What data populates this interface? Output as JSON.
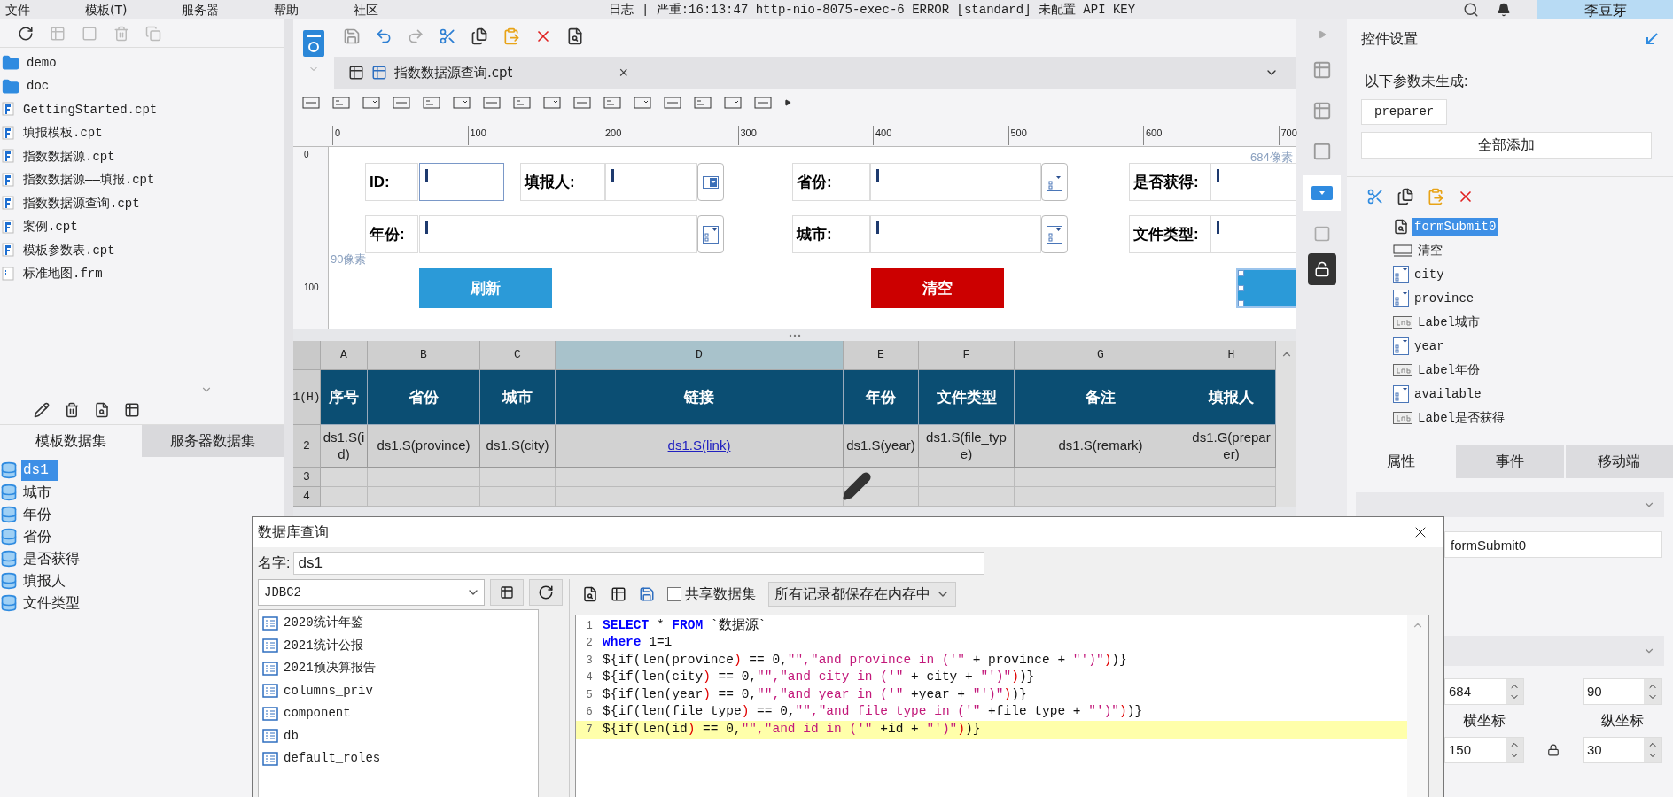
{
  "menu": [
    "文件",
    "模板(T)",
    "服务器",
    "帮助",
    "社区"
  ],
  "log": "日志 | 严重:16:13:47 http-nio-8075-exec-6 ERROR [standard] 未配置 API KEY",
  "user": "李豆芽",
  "file_tree": [
    {
      "label": "demo",
      "kind": "folder"
    },
    {
      "label": "doc",
      "kind": "folder"
    },
    {
      "label": "GettingStarted.cpt",
      "kind": "cpt"
    },
    {
      "label": "填报模板.cpt",
      "kind": "cpt"
    },
    {
      "label": "指数数据源.cpt",
      "kind": "cpt"
    },
    {
      "label": "指数数据源——填报.cpt",
      "kind": "cpt"
    },
    {
      "label": "指数数据源查询.cpt",
      "kind": "cpt"
    },
    {
      "label": "案例.cpt",
      "kind": "cpt"
    },
    {
      "label": "模板参数表.cpt",
      "kind": "cpt"
    },
    {
      "label": "标准地图.frm",
      "kind": "frm"
    }
  ],
  "dataset_tabs": [
    {
      "label": "模板数据集",
      "selected": true
    },
    {
      "label": "服务器数据集",
      "selected": false
    }
  ],
  "datasets": [
    {
      "label": "ds1",
      "selected": true
    },
    {
      "label": "城市",
      "selected": false
    },
    {
      "label": "年份",
      "selected": false
    },
    {
      "label": "省份",
      "selected": false
    },
    {
      "label": "是否获得",
      "selected": false
    },
    {
      "label": "填报人",
      "selected": false
    },
    {
      "label": "文件类型",
      "selected": false
    }
  ],
  "editor_tab": {
    "label": "指数数据源查询.cpt",
    "close": "×"
  },
  "ruler": [
    "0",
    "100",
    "200",
    "300",
    "400",
    "500",
    "600",
    "700"
  ],
  "vruler": [
    "0",
    "100"
  ],
  "canvas": {
    "width_note": "684像素",
    "height_note": "90像素",
    "widgets": [
      {
        "kind": "label",
        "text": "ID:"
      },
      {
        "kind": "input",
        "focused": true
      },
      {
        "kind": "label",
        "text": "填报人:"
      },
      {
        "kind": "input",
        "focused": false
      },
      {
        "kind": "dropdown"
      },
      {
        "kind": "label",
        "text": "省份:"
      },
      {
        "kind": "input",
        "focused": false
      },
      {
        "kind": "picker"
      },
      {
        "kind": "label",
        "text": "是否获得:"
      },
      {
        "kind": "input",
        "focused": false
      },
      {
        "kind": "label",
        "text": "年份:"
      },
      {
        "kind": "input",
        "focused": false
      },
      {
        "kind": "picker"
      },
      {
        "kind": "label",
        "text": "城市:"
      },
      {
        "kind": "input",
        "focused": false
      },
      {
        "kind": "picker"
      },
      {
        "kind": "label",
        "text": "文件类型:"
      },
      {
        "kind": "input",
        "focused": false
      },
      {
        "kind": "button",
        "text": "刷新",
        "color": "#2b9ad8",
        "selected": false
      },
      {
        "kind": "button",
        "text": "清空",
        "color": "#cc0000",
        "selected": false
      },
      {
        "kind": "button",
        "color": "#2b9ad8",
        "selected": true
      }
    ]
  },
  "sheet": {
    "columns": [
      {
        "label": "A",
        "selected": false
      },
      {
        "label": "B",
        "selected": false
      },
      {
        "label": "C",
        "selected": false
      },
      {
        "label": "D",
        "selected": true
      },
      {
        "label": "E",
        "selected": false
      },
      {
        "label": "F",
        "selected": false
      },
      {
        "label": "G",
        "selected": false
      },
      {
        "label": "H",
        "selected": false
      }
    ],
    "rows": [
      {
        "label": "1(H)",
        "kind": "header",
        "cells": [
          "序号",
          "省份",
          "城市",
          "链接",
          "年份",
          "文件类型",
          "备注",
          "填报人"
        ]
      },
      {
        "label": "2",
        "kind": "data",
        "cells": [
          {
            "text": "ds1.S(id)",
            "kind": "formula"
          },
          {
            "text": "ds1.S(province)",
            "kind": "formula"
          },
          {
            "text": "ds1.S(city)",
            "kind": "formula"
          },
          {
            "text": "ds1.S(link)",
            "kind": "link"
          },
          {
            "text": "ds1.S(year)",
            "kind": "formula"
          },
          {
            "text": "ds1.S(file_type)",
            "kind": "formula"
          },
          {
            "text": "ds1.S(remark)",
            "kind": "formula"
          },
          {
            "text": "ds1.G(preparer)",
            "kind": "formula"
          }
        ]
      },
      {
        "label": "3",
        "kind": "empty",
        "cells": []
      },
      {
        "label": "4",
        "kind": "empty",
        "cells": []
      }
    ]
  },
  "panel": {
    "title": "控件设置",
    "notice": "以下参数未生成:",
    "params": [
      "preparer"
    ],
    "add_all": "全部添加",
    "tree": [
      {
        "label": "formSubmit0",
        "kind": "submit",
        "selected": true
      },
      {
        "label": "清空",
        "kind": "button",
        "selected": false
      },
      {
        "label": "city",
        "kind": "combo",
        "selected": false
      },
      {
        "label": "province",
        "kind": "combo",
        "selected": false
      },
      {
        "label": "Label城市",
        "kind": "label",
        "selected": false
      },
      {
        "label": "year",
        "kind": "combo",
        "selected": false
      },
      {
        "label": "Label年份",
        "kind": "label",
        "selected": false
      },
      {
        "label": "available",
        "kind": "combo",
        "selected": false
      },
      {
        "label": "Label是否获得",
        "kind": "label",
        "selected": false
      }
    ],
    "tabs": [
      {
        "label": "属性",
        "selected": true
      },
      {
        "label": "事件",
        "selected": false
      },
      {
        "label": "移动端",
        "selected": false
      }
    ],
    "widget_name": "formSubmit0",
    "position": [
      {
        "value": "684",
        "label": "横坐标"
      },
      {
        "value": "90",
        "label": "纵坐标"
      }
    ],
    "size": [
      "150",
      "30"
    ]
  },
  "dialog": {
    "title": "数据库查询",
    "name_label": "名字:",
    "name_value": "ds1",
    "connection": "JDBC2",
    "tables": [
      "2020统计年鉴",
      "2021统计公报",
      "2021预决算报告",
      "columns_priv",
      "component",
      "db",
      "default_roles"
    ],
    "shared": {
      "label": "共享数据集",
      "checked": false
    },
    "storage": "所有记录都保存在内存中",
    "code": [
      {
        "n": "1",
        "highlighted": false,
        "tokens": [
          {
            "t": "SELECT",
            "kind": "kw"
          },
          {
            "t": " * ",
            "kind": "plain"
          },
          {
            "t": "FROM",
            "kind": "kw"
          },
          {
            "t": " `数据源`",
            "kind": "plain"
          }
        ]
      },
      {
        "n": "2",
        "highlighted": false,
        "tokens": [
          {
            "t": "where",
            "kind": "kw"
          },
          {
            "t": " 1=1",
            "kind": "plain"
          }
        ]
      },
      {
        "n": "3",
        "highlighted": false,
        "tokens": [
          {
            "t": "${if(len(province",
            "kind": "plain"
          },
          {
            "t": ")",
            "kind": "paren"
          },
          {
            "t": " == 0,",
            "kind": "plain"
          },
          {
            "t": "\"\",\"and province in ('\"",
            "kind": "str"
          },
          {
            "t": " + province + ",
            "kind": "plain"
          },
          {
            "t": "\"')\"",
            "kind": "str"
          },
          {
            "t": ")",
            "kind": "paren"
          },
          {
            "t": ")}",
            "kind": "plain"
          }
        ]
      },
      {
        "n": "4",
        "highlighted": false,
        "tokens": [
          {
            "t": "${if(len(city",
            "kind": "plain"
          },
          {
            "t": ")",
            "kind": "paren"
          },
          {
            "t": " == 0,",
            "kind": "plain"
          },
          {
            "t": "\"\",\"and city in ('\"",
            "kind": "str"
          },
          {
            "t": " + city + ",
            "kind": "plain"
          },
          {
            "t": "\"')\"",
            "kind": "str"
          },
          {
            "t": ")",
            "kind": "paren"
          },
          {
            "t": ")}",
            "kind": "plain"
          }
        ]
      },
      {
        "n": "5",
        "highlighted": false,
        "tokens": [
          {
            "t": "${if(len(year",
            "kind": "plain"
          },
          {
            "t": ")",
            "kind": "paren"
          },
          {
            "t": " == 0,",
            "kind": "plain"
          },
          {
            "t": "\"\",\"and year in ('\"",
            "kind": "str"
          },
          {
            "t": " +year + ",
            "kind": "plain"
          },
          {
            "t": "\"')\"",
            "kind": "str"
          },
          {
            "t": ")",
            "kind": "paren"
          },
          {
            "t": ")}",
            "kind": "plain"
          }
        ]
      },
      {
        "n": "6",
        "highlighted": false,
        "tokens": [
          {
            "t": "${if(len(file_type",
            "kind": "plain"
          },
          {
            "t": ")",
            "kind": "paren"
          },
          {
            "t": " == 0,",
            "kind": "plain"
          },
          {
            "t": "\"\",\"and file_type in ('\"",
            "kind": "str"
          },
          {
            "t": " +file_type + ",
            "kind": "plain"
          },
          {
            "t": "\"')\"",
            "kind": "str"
          },
          {
            "t": ")",
            "kind": "paren"
          },
          {
            "t": ")}",
            "kind": "plain"
          }
        ]
      },
      {
        "n": "7",
        "highlighted": true,
        "tokens": [
          {
            "t": "${if(len(id",
            "kind": "plain"
          },
          {
            "t": ")",
            "kind": "paren"
          },
          {
            "t": " == 0,",
            "kind": "plain"
          },
          {
            "t": "\"\",\"and id in ('\"",
            "kind": "str"
          },
          {
            "t": " +id + ",
            "kind": "plain"
          },
          {
            "t": "\"')\"",
            "kind": "str"
          },
          {
            "t": ")",
            "kind": "paren"
          },
          {
            "t": ")}",
            "kind": "plain"
          }
        ]
      }
    ]
  }
}
